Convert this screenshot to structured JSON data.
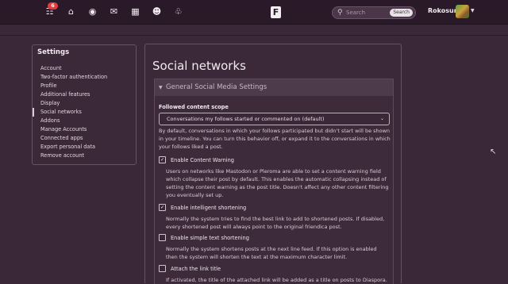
{
  "topbar": {
    "nav_icons": [
      "apps-icon",
      "home-icon",
      "network-icon",
      "mail-icon",
      "calendar-icon",
      "contacts-icon",
      "bell-icon"
    ],
    "notification_count": "6",
    "search_placeholder": "Search",
    "search_button": "Search",
    "username": "Rokosun"
  },
  "sidebar": {
    "title": "Settings",
    "items": [
      {
        "label": "Account"
      },
      {
        "label": "Two-factor authentication"
      },
      {
        "label": "Profile"
      },
      {
        "label": "Additional features"
      },
      {
        "label": "Display"
      },
      {
        "label": "Social networks"
      },
      {
        "label": "Addons"
      },
      {
        "label": "Manage Accounts"
      },
      {
        "label": "Connected apps"
      },
      {
        "label": "Export personal data"
      },
      {
        "label": "Remove account"
      }
    ],
    "active": "Social networks"
  },
  "main": {
    "title": "Social networks",
    "section_title": "General Social Media Settings",
    "scope_label": "Followed content scope",
    "scope_value": "Conversations my follows started or commented on (default)",
    "scope_help": "By default, conversations in which your follows participated but didn't start will be shown in your timeline. You can turn this behavior off, or expand it to the conversations in which your follows liked a post.",
    "options": [
      {
        "label": "Enable Content Warning",
        "checked": true,
        "desc": "Users on networks like Mastodon or Pleroma are able to set a content warning field which collapse their post by default. This enables the automatic collapsing instead of setting the content warning as the post title. Doesn't affect any other content filtering you eventually set up."
      },
      {
        "label": "Enable intelligent shortening",
        "checked": true,
        "desc": "Normally the system tries to find the best link to add to shortened posts. If disabled, every shortened post will always point to the original friendica post."
      },
      {
        "label": "Enable simple text shortening",
        "checked": false,
        "desc": "Normally the system shortens posts at the next line feed. If this option is enabled then the system will shorten the text at the maximum character limit."
      },
      {
        "label": "Attach the link title",
        "checked": false,
        "desc": "If activated, the title of the attached link will be added as a title on posts to Diaspora."
      }
    ]
  }
}
